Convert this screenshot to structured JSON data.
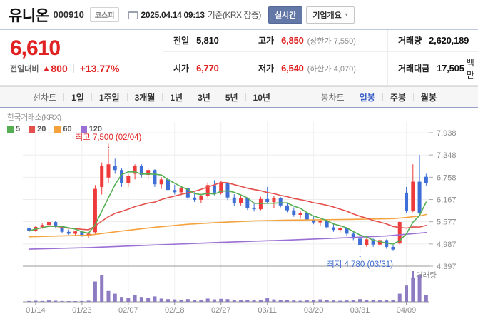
{
  "header": {
    "title": "유니온",
    "code": "000910",
    "market_badge": "코스피",
    "datetime": "2025.04.14 09:13",
    "datetime_suffix": "기준(KRX 장중)",
    "realtime_button": "실시간",
    "overview_button": "기업개요",
    "overview_chevron": "▾"
  },
  "quote": {
    "price": "6,610",
    "change_label": "전일대비",
    "change_arrow": "▲",
    "change_value": "800",
    "change_percent": "+13.77%"
  },
  "info": {
    "cells": [
      {
        "label": "전일",
        "value": "5,810",
        "red": false,
        "extra": "",
        "unit": ""
      },
      {
        "label": "고가",
        "value": "6,850",
        "red": true,
        "extra": "(상한가 7,550)",
        "unit": ""
      },
      {
        "label": "거래량",
        "value": "2,620,189",
        "red": false,
        "extra": "",
        "unit": ""
      },
      {
        "label": "시가",
        "value": "6,770",
        "red": true,
        "extra": "",
        "unit": ""
      },
      {
        "label": "저가",
        "value": "6,540",
        "red": true,
        "extra": "(하한가 4,070)",
        "unit": ""
      },
      {
        "label": "거래대금",
        "value": "17,505",
        "red": false,
        "extra": "",
        "unit": "백만"
      }
    ]
  },
  "tabs": {
    "line_label": "선차트",
    "line_tabs": [
      "1일",
      "1주일",
      "3개월",
      "1년",
      "3년",
      "5년",
      "10년"
    ],
    "candle_label": "봉차트",
    "candle_tabs": [
      "일봉",
      "주봉",
      "월봉"
    ],
    "selected": "일봉"
  },
  "chart": {
    "source": "한국거래소(KRX)",
    "ma_legend": [
      {
        "label": "5",
        "color": "#55ae51"
      },
      {
        "label": "20",
        "color": "#e4504c"
      },
      {
        "label": "60",
        "color": "#f5a23c"
      },
      {
        "label": "120",
        "color": "#9b6fd4"
      }
    ],
    "volume_legend": "거래량"
  },
  "chart_data": {
    "type": "candlestick+volume",
    "title": "유니온(000910) 일봉 차트",
    "y_ticks": [
      {
        "v": 7938,
        "label": "7,938"
      },
      {
        "v": 7348,
        "label": "7,348"
      },
      {
        "v": 6758,
        "label": "6,758"
      },
      {
        "v": 6167,
        "label": "6,167"
      },
      {
        "v": 5577,
        "label": "5,577"
      },
      {
        "v": 4987,
        "label": "4,987"
      },
      {
        "v": 4397,
        "label": "4,397"
      }
    ],
    "ylim": [
      4397,
      7938
    ],
    "x_tick_indices": [
      1,
      8,
      15,
      22,
      29,
      36,
      43,
      50,
      57
    ],
    "x_tick_labels": [
      "01/14",
      "01/23",
      "02/07",
      "02/18",
      "02/27",
      "03/11",
      "03/20",
      "03/31",
      "04/09"
    ],
    "annotations": {
      "high": {
        "label": "최고 7,500 (02/04)",
        "index": 12,
        "value": 7500,
        "arrow": "↓"
      },
      "low": {
        "label": "최저 4,780 (03/31)",
        "index": 50,
        "value": 4780,
        "arrow": "↑"
      }
    },
    "candle_columns": [
      "date",
      "open",
      "high",
      "low",
      "close",
      "volume_rel"
    ],
    "candles": [
      [
        "01/13",
        5400,
        5450,
        5300,
        5330,
        3
      ],
      [
        "01/14",
        5330,
        5470,
        5310,
        5440,
        4
      ],
      [
        "01/15",
        5440,
        5530,
        5390,
        5490,
        3
      ],
      [
        "01/16",
        5490,
        5620,
        5450,
        5570,
        5
      ],
      [
        "01/17",
        5570,
        5590,
        5420,
        5450,
        4
      ],
      [
        "01/20",
        5450,
        5470,
        5280,
        5310,
        3
      ],
      [
        "01/21",
        5310,
        5370,
        5230,
        5260,
        2
      ],
      [
        "01/22",
        5260,
        5340,
        5210,
        5320,
        2
      ],
      [
        "01/23",
        5320,
        5330,
        5180,
        5210,
        3
      ],
      [
        "01/24",
        5210,
        5300,
        5160,
        5260,
        4
      ],
      [
        "01/31",
        5300,
        6550,
        5260,
        6450,
        75
      ],
      [
        "02/03",
        6500,
        7150,
        6300,
        7050,
        100
      ],
      [
        "02/04",
        6750,
        7500,
        6600,
        7100,
        40
      ],
      [
        "02/05",
        7050,
        7250,
        6850,
        6950,
        30
      ],
      [
        "02/06",
        6950,
        7000,
        6500,
        6600,
        18
      ],
      [
        "02/07",
        6600,
        6850,
        6500,
        6800,
        15
      ],
      [
        "02/10",
        6850,
        7100,
        6700,
        7050,
        25
      ],
      [
        "02/11",
        7050,
        7100,
        6750,
        6820,
        18
      ],
      [
        "02/12",
        6820,
        6990,
        6700,
        6950,
        14
      ],
      [
        "02/13",
        6950,
        6970,
        6500,
        6570,
        20
      ],
      [
        "02/14",
        6570,
        6760,
        6450,
        6700,
        12
      ],
      [
        "02/17",
        6700,
        6720,
        6350,
        6420,
        10
      ],
      [
        "02/18",
        6420,
        6560,
        6300,
        6360,
        9
      ],
      [
        "02/19",
        6360,
        6520,
        6280,
        6470,
        8
      ],
      [
        "02/20",
        6470,
        6490,
        6150,
        6220,
        10
      ],
      [
        "02/21",
        6220,
        6360,
        6100,
        6160,
        7
      ],
      [
        "02/24",
        6160,
        6320,
        6080,
        6270,
        6
      ],
      [
        "02/25",
        6270,
        6620,
        6220,
        6550,
        12
      ],
      [
        "02/26",
        6550,
        6680,
        6280,
        6350,
        9
      ],
      [
        "02/27",
        6350,
        6650,
        6300,
        6600,
        11
      ],
      [
        "02/28",
        6600,
        6620,
        6150,
        6220,
        10
      ],
      [
        "03/04",
        6220,
        6310,
        6000,
        6070,
        8
      ],
      [
        "03/05",
        6070,
        6260,
        6010,
        6200,
        6
      ],
      [
        "03/06",
        6200,
        6220,
        5890,
        5950,
        7
      ],
      [
        "03/07",
        5950,
        6090,
        5850,
        5910,
        6
      ],
      [
        "03/10",
        5910,
        6240,
        5880,
        6180,
        8
      ],
      [
        "03/11",
        6180,
        6500,
        6050,
        6100,
        13
      ],
      [
        "03/12",
        6100,
        6270,
        5930,
        6210,
        9
      ],
      [
        "03/13",
        6210,
        6230,
        5960,
        6010,
        6
      ],
      [
        "03/14",
        6010,
        6090,
        5830,
        5880,
        6
      ],
      [
        "03/17",
        5880,
        5960,
        5710,
        5760,
        5
      ],
      [
        "03/18",
        5760,
        5860,
        5660,
        5810,
        4
      ],
      [
        "03/19",
        5810,
        5830,
        5590,
        5630,
        5
      ],
      [
        "03/20",
        5630,
        5710,
        5510,
        5560,
        7
      ],
      [
        "03/21",
        5560,
        5660,
        5460,
        5610,
        9
      ],
      [
        "03/24",
        5610,
        5630,
        5390,
        5430,
        7
      ],
      [
        "03/25",
        5430,
        5510,
        5310,
        5360,
        5
      ],
      [
        "03/26",
        5360,
        5460,
        5290,
        5410,
        4
      ],
      [
        "03/27",
        5410,
        5430,
        5210,
        5260,
        5
      ],
      [
        "03/28",
        5260,
        5310,
        5090,
        5130,
        6
      ],
      [
        "03/31",
        5130,
        5160,
        4780,
        4960,
        10
      ],
      [
        "04/01",
        4960,
        5160,
        4910,
        5110,
        8
      ],
      [
        "04/02",
        5110,
        5130,
        4910,
        4970,
        6
      ],
      [
        "04/03",
        4970,
        5160,
        4930,
        5090,
        5
      ],
      [
        "04/04",
        5090,
        5110,
        4860,
        4910,
        6
      ],
      [
        "04/07",
        4910,
        4960,
        4800,
        4840,
        8
      ],
      [
        "04/08",
        5000,
        5600,
        4960,
        5570,
        30
      ],
      [
        "04/09",
        6350,
        6500,
        5810,
        5860,
        60
      ],
      [
        "04/10",
        5860,
        7100,
        5830,
        6640,
        90
      ],
      [
        "04/11",
        6640,
        7348,
        5790,
        5810,
        100
      ],
      [
        "04/14",
        6770,
        6850,
        6540,
        6610,
        25
      ]
    ],
    "ma": {
      "ma5_window": 5,
      "ma20_window": 20,
      "ma60_points": [
        [
          0,
          5180
        ],
        [
          9,
          5220
        ],
        [
          14,
          5330
        ],
        [
          19,
          5430
        ],
        [
          24,
          5510
        ],
        [
          29,
          5560
        ],
        [
          34,
          5600
        ],
        [
          39,
          5620
        ],
        [
          44,
          5630
        ],
        [
          49,
          5640
        ],
        [
          52,
          5650
        ],
        [
          55,
          5660
        ],
        [
          57,
          5690
        ],
        [
          59,
          5730
        ],
        [
          60,
          5770
        ]
      ],
      "ma120_points": [
        [
          0,
          4850
        ],
        [
          9,
          4890
        ],
        [
          19,
          4960
        ],
        [
          29,
          5030
        ],
        [
          39,
          5090
        ],
        [
          49,
          5160
        ],
        [
          54,
          5200
        ],
        [
          60,
          5290
        ]
      ]
    },
    "colors": {
      "up": "#ee3a3a",
      "down": "#3e6fd6",
      "ma5": "#55ae51",
      "ma20": "#e4504c",
      "ma60": "#f5a23c",
      "ma120": "#9b6fd4",
      "volume": "#8e7cc3",
      "grid": "#ededed",
      "grid_v": "#f1f1f1",
      "axis_line": "#999999",
      "axis_text": "#8b8b8b",
      "annotation_high": "#e02020",
      "annotation_low": "#3b6bd0"
    },
    "legend_position": "top-left",
    "grid": true
  }
}
